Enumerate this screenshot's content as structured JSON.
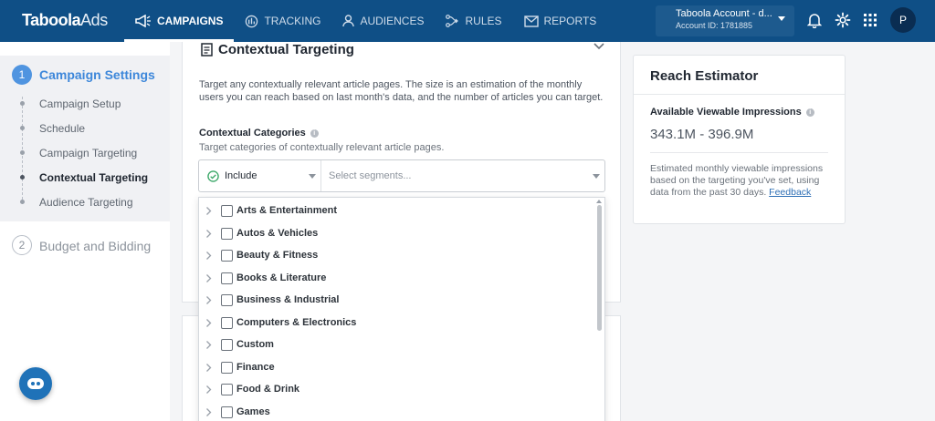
{
  "brand": {
    "logo_main": "Taboola",
    "logo_sub": "Ads"
  },
  "nav": {
    "items": [
      {
        "label": "CAMPAIGNS",
        "icon": "megaphone-icon",
        "active": true
      },
      {
        "label": "TRACKING",
        "icon": "tracking-icon"
      },
      {
        "label": "AUDIENCES",
        "icon": "person-icon"
      },
      {
        "label": "RULES",
        "icon": "rules-icon"
      },
      {
        "label": "REPORTS",
        "icon": "mail-icon"
      }
    ]
  },
  "account": {
    "name": "Taboola Account - d...",
    "id": "Account ID: 1781885"
  },
  "user": {
    "initial": "P"
  },
  "sidebar": {
    "sections": [
      {
        "number": "1",
        "title": "Campaign Settings",
        "items": [
          {
            "label": "Campaign Setup"
          },
          {
            "label": "Schedule"
          },
          {
            "label": "Campaign Targeting"
          },
          {
            "label": "Contextual Targeting",
            "active": true
          },
          {
            "label": "Audience Targeting"
          }
        ]
      },
      {
        "number": "2",
        "title": "Budget and Bidding"
      }
    ]
  },
  "card": {
    "title": "Contextual Targeting",
    "description": "Target any contextually relevant article pages. The size is an estimation of the monthly users you can reach based on last month's data, and the number of articles you can target.",
    "categories_label": "Contextual Categories",
    "categories_sub": "Target categories of contextually relevant article pages.",
    "include_label": "Include",
    "segments_placeholder": "Select segments..."
  },
  "dropdown": {
    "items": [
      {
        "label": "Arts & Entertainment"
      },
      {
        "label": "Autos & Vehicles"
      },
      {
        "label": "Beauty & Fitness"
      },
      {
        "label": "Books & Literature"
      },
      {
        "label": "Business & Industrial"
      },
      {
        "label": "Computers & Electronics"
      },
      {
        "label": "Custom"
      },
      {
        "label": "Finance"
      },
      {
        "label": "Food & Drink"
      },
      {
        "label": "Games"
      }
    ]
  },
  "reach": {
    "title": "Reach Estimator",
    "label": "Available Viewable Impressions",
    "range": "343.1M - 396.9M",
    "note": "Estimated monthly viewable impressions based on the targeting you've set, using data from the past 30 days.",
    "feedback": "Feedback"
  },
  "colors": {
    "topbar": "#0f4f86",
    "accent": "#3d87da",
    "include_check": "#3fa96b"
  }
}
